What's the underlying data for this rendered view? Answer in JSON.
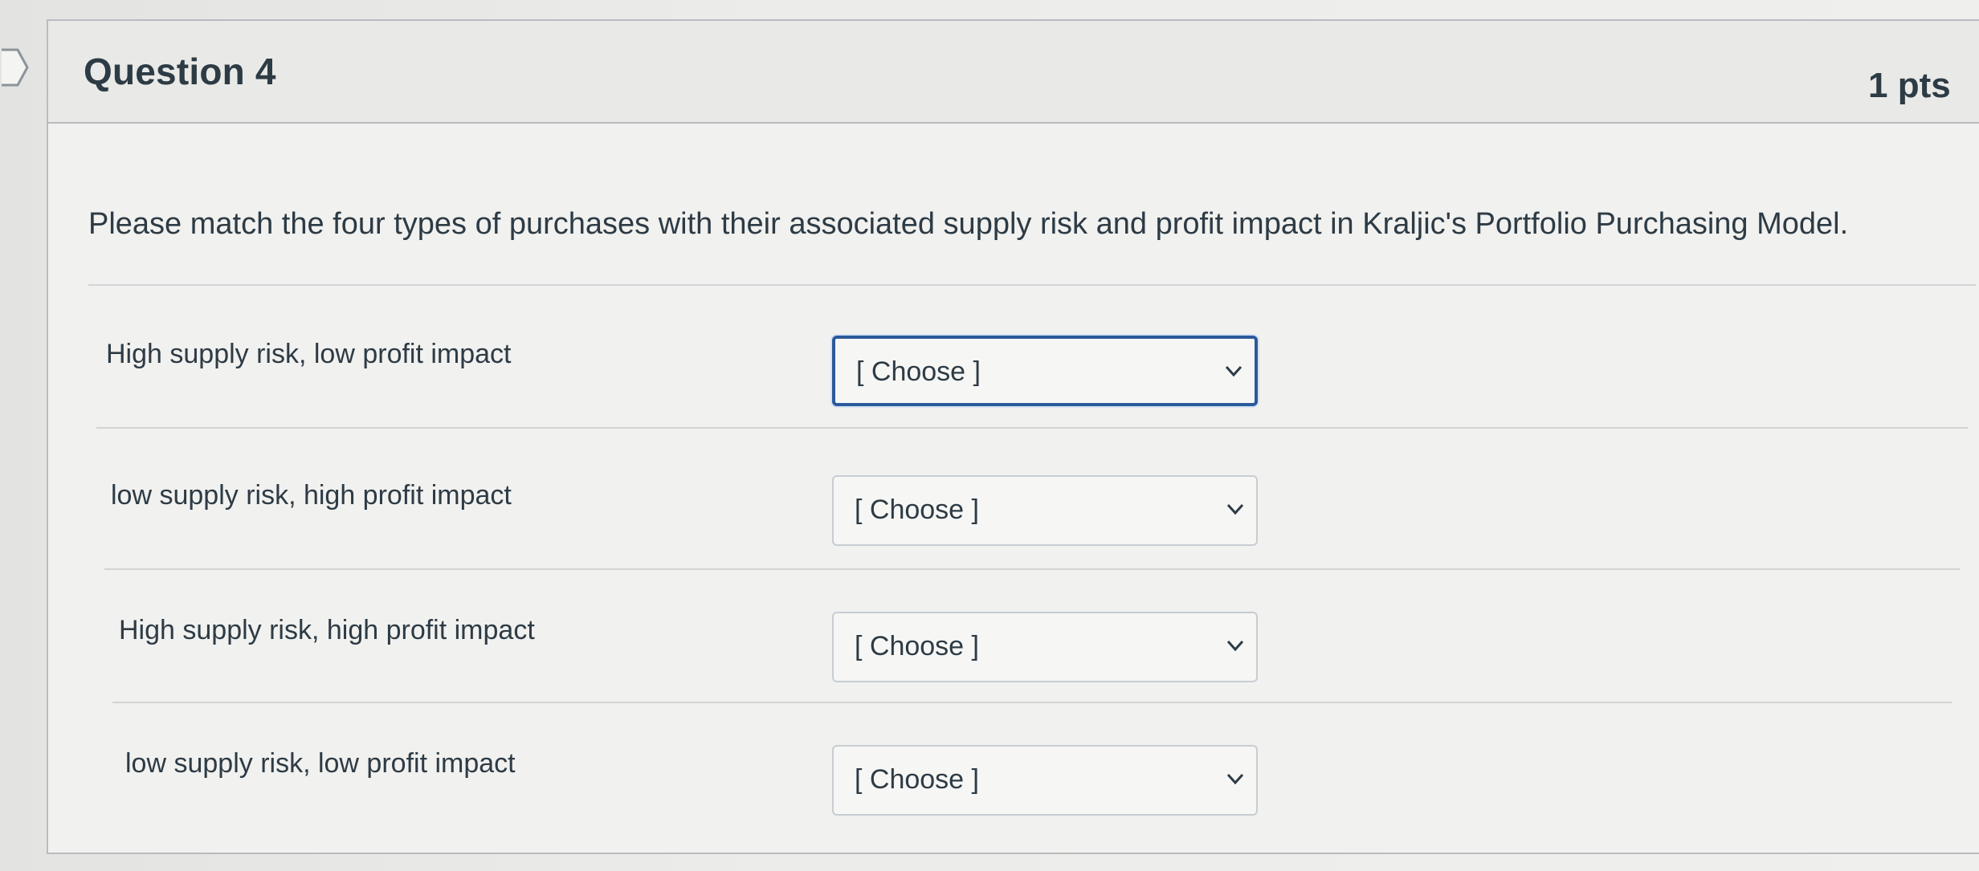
{
  "question": {
    "title": "Question 4",
    "points": "1 pts",
    "prompt": "Please match the four types of purchases with their associated supply risk and profit impact in Kraljic's Portfolio Purchasing Model."
  },
  "matches": [
    {
      "label": "High supply risk, low profit impact",
      "selected": "[ Choose ]",
      "focused": true
    },
    {
      "label": "low supply risk, high profit impact",
      "selected": "[ Choose ]",
      "focused": false
    },
    {
      "label": "High supply risk, high profit impact",
      "selected": "[ Choose ]",
      "focused": false
    },
    {
      "label": "low supply risk, low profit impact",
      "selected": "[ Choose ]",
      "focused": false
    }
  ],
  "colors": {
    "text": "#2d3b45",
    "focus_border": "#2b5a9c",
    "border": "#c7cdd1"
  }
}
